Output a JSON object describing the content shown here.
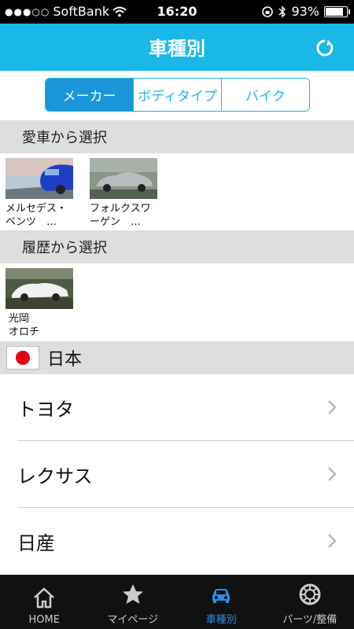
{
  "status": {
    "carrier": "SoftBank",
    "time": "16:20",
    "battery": "93%",
    "battery_level": 0.93
  },
  "header": {
    "title": "車種別"
  },
  "segments": [
    {
      "label": "メーカー",
      "active": true
    },
    {
      "label": "ボディタイプ",
      "active": false
    },
    {
      "label": "バイク",
      "active": false
    }
  ],
  "my_car": {
    "header": "愛車から選択",
    "items": [
      {
        "label": "メルセデス・\nベンツ　…"
      },
      {
        "label": "フォルクスワ\nーゲン　…"
      }
    ]
  },
  "history": {
    "header": "履歴から選択",
    "items": [
      {
        "label": "光岡\nオロチ"
      }
    ]
  },
  "country": {
    "name": "日本"
  },
  "makers": [
    {
      "name": "トヨタ"
    },
    {
      "name": "レクサス"
    },
    {
      "name": "日産"
    }
  ],
  "tabs": [
    {
      "label": "HOME",
      "icon": "home-icon",
      "active": false
    },
    {
      "label": "マイページ",
      "icon": "star-icon",
      "active": false
    },
    {
      "label": "車種別",
      "icon": "car-icon",
      "active": true
    },
    {
      "label": "パーツ/整備",
      "icon": "tire-icon",
      "active": false
    }
  ],
  "colors": {
    "accent": "#1ab8e6",
    "segment_active": "#1a96d8",
    "tab_active": "#2b8de0"
  }
}
